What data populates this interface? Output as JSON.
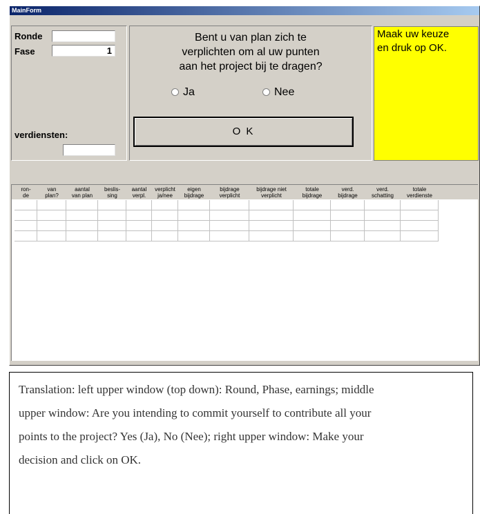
{
  "window": {
    "title": "MainForm"
  },
  "left_panel": {
    "ronde_label": "Ronde",
    "ronde_value": "",
    "fase_label": "Fase",
    "fase_value": "1",
    "verdiensten_label": "verdiensten:",
    "verdiensten_value": ""
  },
  "question": {
    "lines": [
      "Bent u van plan zich te",
      "verplichten om al uw punten",
      "aan het project bij te dragen?"
    ],
    "option_yes": "Ja",
    "option_no": "Nee"
  },
  "ok_button": {
    "label": "O K"
  },
  "instruction": {
    "lines": [
      "Maak uw keuze",
      "en druk op OK."
    ]
  },
  "table": {
    "headers": [
      [
        "ron-",
        "de"
      ],
      [
        "van",
        "plan?"
      ],
      [
        "aantal",
        "van plan"
      ],
      [
        "beslis-",
        "sing"
      ],
      [
        "aantal",
        "verpl."
      ],
      [
        "verplicht",
        "ja/nee"
      ],
      [
        "eigen",
        "bijdrage"
      ],
      [
        "bijdrage",
        "verplicht"
      ],
      [
        "bijdrage niet",
        "verplicht"
      ],
      [
        "totale",
        "bijdrage"
      ],
      [
        "verd.",
        "bijdrage"
      ],
      [
        "verd.",
        "schatting"
      ],
      [
        "totale",
        "verdienste"
      ]
    ],
    "visible_rows": 4
  },
  "caption": {
    "lines": [
      "Translation: left upper window (top down): Round, Phase, earnings; middle",
      "upper window: Are you intending to commit yourself to contribute all your",
      "points to the project? Yes (Ja), No (Nee); right upper window: Make your",
      "decision and click on OK."
    ]
  }
}
